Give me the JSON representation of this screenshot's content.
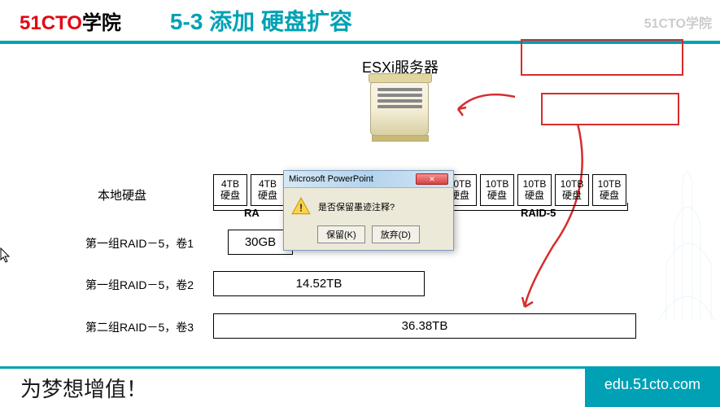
{
  "logo": {
    "brand": "51CTO",
    "suffix": "学院"
  },
  "title": "5-3 添加 硬盘扩容",
  "watermark": "51CTO学院",
  "diagram": {
    "server_label": "ESXi服务器",
    "local_disk_label": "本地硬盘",
    "disks": [
      {
        "size": "4TB",
        "label": "硬盘"
      },
      {
        "size": "4TB",
        "label": "硬盘"
      },
      {
        "size": "10TB",
        "label": "硬盘"
      },
      {
        "size": "10TB",
        "label": "硬盘"
      },
      {
        "size": "10TB",
        "label": "硬盘"
      },
      {
        "size": "10TB",
        "label": "硬盘"
      },
      {
        "size": "10TB",
        "label": "硬盘"
      }
    ],
    "raid_label_left": "RA",
    "raid_label_right": "RAID-5",
    "volumes": [
      {
        "label": "第一组RAID－5，卷1",
        "size": "30GB"
      },
      {
        "label": "第一组RAID－5，卷2",
        "size": "14.52TB"
      },
      {
        "label": "第二组RAID－5，卷3",
        "size": "36.38TB"
      }
    ]
  },
  "dialog": {
    "title": "Microsoft PowerPoint",
    "message": "是否保留墨迹注释?",
    "keep": "保留(K)",
    "discard": "放弃(D)",
    "close": "✕"
  },
  "footer": {
    "tagline": "为梦想增值！",
    "url": "edu.51cto.com"
  }
}
